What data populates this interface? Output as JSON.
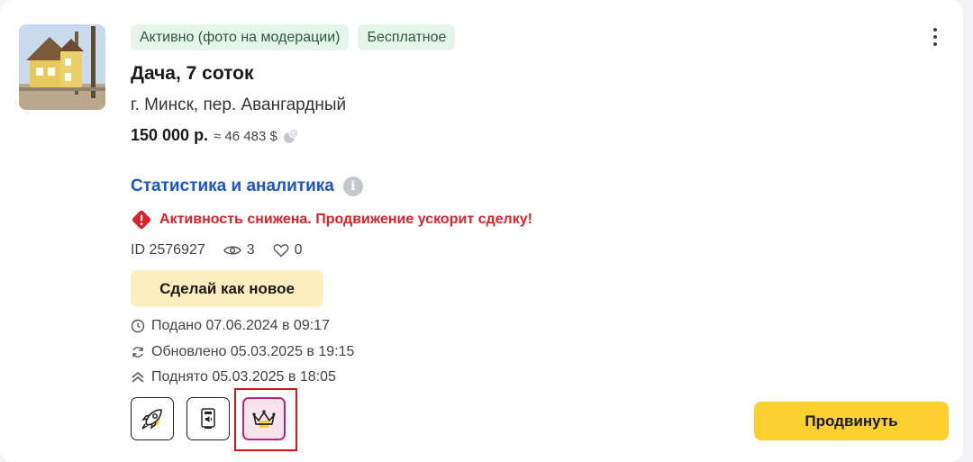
{
  "listing": {
    "badges": [
      "Активно (фото на модерации)",
      "Бесплатное"
    ],
    "title": "Дача, 7 соток",
    "address": "г. Минск, пер. Авангардный",
    "price": "150 000 р.",
    "price_usd": "≈ 46 483 $",
    "stats_link": "Статистика и аналитика",
    "info_icon": "i",
    "warning": "Активность снижена. Продвижение ускорит сделку!",
    "id_label": "ID 2576927",
    "views": "3",
    "favorites": "0",
    "renew_button": "Сделай как новое",
    "dates": {
      "posted": "Подано 07.06.2024 в 09:17",
      "updated": "Обновлено 05.03.2025 в 19:15",
      "raised": "Поднято 05.03.2025 в 18:05"
    },
    "promote_button": "Продвинуть"
  },
  "services": [
    {
      "icon": "rocket-icon"
    },
    {
      "icon": "announcement-icon"
    },
    {
      "icon": "crown-icon",
      "selected": true
    }
  ],
  "colors": {
    "accent_yellow": "#fcd02e",
    "link_blue": "#1c55c4",
    "warning_red": "#d8232a",
    "badge_green_bg": "#e6f5ec",
    "vip_pink": "#b8277b"
  }
}
